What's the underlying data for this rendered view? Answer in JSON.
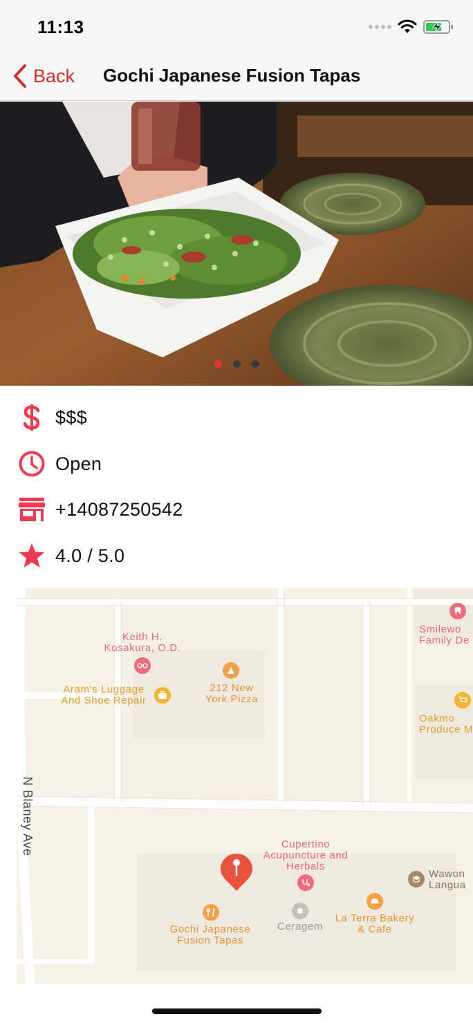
{
  "status_bar": {
    "time": "11:13"
  },
  "nav": {
    "back_label": "Back",
    "title": "Gochi Japanese Fusion Tapas"
  },
  "photo": {
    "page_count": 3,
    "current_page": 1
  },
  "details": {
    "price": "$$$",
    "hours": "Open",
    "phone": "+14087250542",
    "rating": "4.0 / 5.0"
  },
  "map": {
    "street": "N Blaney Ave",
    "pins": {
      "keith": "Keith H. Kosakura, O.D.",
      "arams": "Aram's Luggage And Shoe Repair",
      "pizza": "212 New York Pizza",
      "smile": "Smilewo Family De",
      "oakmont": "Oakmo Produce M",
      "cupertino": "Cupertino Acupuncture and Herbals",
      "wawon": "Wawon Langua",
      "gochi": "Gochi Japanese Fusion Tapas",
      "ceragem": "Ceragem",
      "laterra": "La Terra Bakery & Cafe"
    }
  },
  "colors": {
    "accent": "#d0312d",
    "icon_red": "#f0384f",
    "poi_orange": "#f3a04a",
    "poi_pink": "#ee6b7c",
    "map_bg": "#f7f1e6",
    "map_block": "#efe9df"
  }
}
